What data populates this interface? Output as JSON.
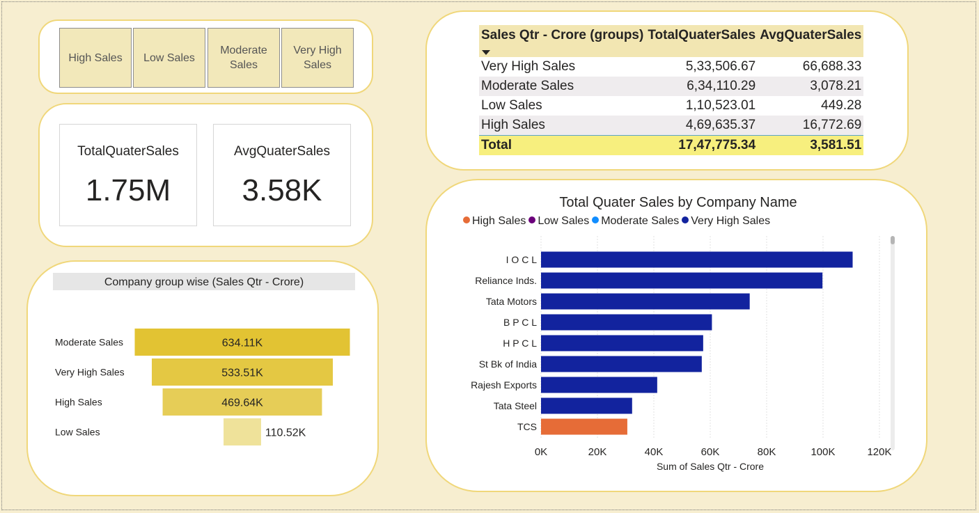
{
  "slicer": {
    "items": [
      {
        "label": "High Sales"
      },
      {
        "label": "Low Sales"
      },
      {
        "label": "Moderate Sales"
      },
      {
        "label": "Very High Sales"
      }
    ]
  },
  "kpis": [
    {
      "label": "TotalQuaterSales",
      "value": "1.75M"
    },
    {
      "label": "AvgQuaterSales",
      "value": "3.58K"
    }
  ],
  "table": {
    "headers": [
      "Sales Qtr - Crore (groups)",
      "TotalQuaterSales",
      "AvgQuaterSales"
    ],
    "rows": [
      [
        "Very High Sales",
        "5,33,506.67",
        "66,688.33"
      ],
      [
        "Moderate Sales",
        "6,34,110.29",
        "3,078.21"
      ],
      [
        "Low Sales",
        "1,10,523.01",
        "449.28"
      ],
      [
        "High Sales",
        "4,69,635.37",
        "16,772.69"
      ]
    ],
    "total": [
      "Total",
      "17,47,775.34",
      "3,581.51"
    ]
  },
  "chart_data": [
    {
      "type": "funnel",
      "title": "Company group wise (Sales Qtr - Crore)",
      "categories": [
        "Moderate Sales",
        "Very High Sales",
        "High Sales",
        "Low Sales"
      ],
      "values": [
        634110.29,
        533506.67,
        469635.37,
        110523.01
      ],
      "labels": [
        "634.11K",
        "533.51K",
        "469.64K",
        "110.52K"
      ],
      "colors": [
        "#e2c333",
        "#e4c843",
        "#e6cd57",
        "#efe29a"
      ]
    },
    {
      "type": "bar",
      "orientation": "horizontal",
      "title": "Total Quater Sales by Company Name",
      "xlabel": "Sum of Sales Qtr - Crore",
      "ylabel": "",
      "xlim": [
        0,
        120000
      ],
      "xticks": [
        0,
        20000,
        40000,
        60000,
        80000,
        100000,
        120000
      ],
      "xtick_labels": [
        "0K",
        "20K",
        "40K",
        "60K",
        "80K",
        "100K",
        "120K"
      ],
      "grid": true,
      "legend": {
        "position": "top",
        "entries": [
          {
            "name": "High Sales",
            "color": "#e66c37"
          },
          {
            "name": "Low Sales",
            "color": "#6b007b"
          },
          {
            "name": "Moderate Sales",
            "color": "#118dff"
          },
          {
            "name": "Very High Sales",
            "color": "#12239e"
          }
        ]
      },
      "categories": [
        "I O C L",
        "Reliance Inds.",
        "Tata Motors",
        "B P C L",
        "H P C L",
        "St Bk of India",
        "Rajesh Exports",
        "Tata Steel",
        "TCS"
      ],
      "values": [
        110500,
        99800,
        74000,
        60600,
        57500,
        57000,
        41200,
        32300,
        30600
      ],
      "groups": [
        "Very High Sales",
        "Very High Sales",
        "Very High Sales",
        "Very High Sales",
        "Very High Sales",
        "Very High Sales",
        "Very High Sales",
        "Very High Sales",
        "High Sales"
      ]
    }
  ]
}
